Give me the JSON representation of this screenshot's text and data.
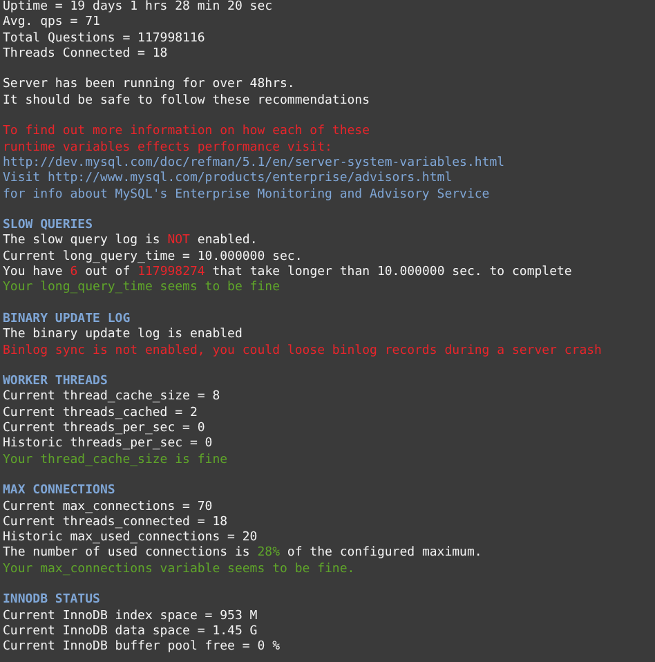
{
  "blocks": [
    {
      "lines": [
        {
          "segments": [
            {
              "text": "Uptime = 19 days 1 hrs 28 min 20 sec",
              "kind": "plain"
            }
          ]
        },
        {
          "segments": [
            {
              "text": "Avg. qps = 71",
              "kind": "plain"
            }
          ]
        },
        {
          "segments": [
            {
              "text": "Total Questions = 117998116",
              "kind": "plain"
            }
          ]
        },
        {
          "segments": [
            {
              "text": "Threads Connected = 18",
              "kind": "plain"
            }
          ]
        }
      ]
    },
    {
      "lines": [
        {
          "segments": [
            {
              "text": "Server has been running for over 48hrs.",
              "kind": "plain"
            }
          ]
        },
        {
          "segments": [
            {
              "text": "It should be safe to follow these recommendations",
              "kind": "plain"
            }
          ]
        }
      ]
    },
    {
      "lines": [
        {
          "segments": [
            {
              "text": "To find out more information on how each of these",
              "kind": "alert"
            }
          ]
        },
        {
          "segments": [
            {
              "text": "runtime variables effects performance visit:",
              "kind": "alert"
            }
          ]
        },
        {
          "segments": [
            {
              "text": "http://dev.mysql.com/doc/refman/5.1/en/server-system-variables.html",
              "kind": "info"
            }
          ]
        },
        {
          "segments": [
            {
              "text": "Visit http://www.mysql.com/products/enterprise/advisors.html",
              "kind": "info"
            }
          ]
        },
        {
          "segments": [
            {
              "text": "for info about MySQL's Enterprise Monitoring and Advisory Service",
              "kind": "info"
            }
          ]
        }
      ]
    },
    {
      "lines": [
        {
          "segments": [
            {
              "text": "SLOW QUERIES",
              "kind": "heading"
            }
          ]
        },
        {
          "segments": [
            {
              "text": "The slow query log is ",
              "kind": "plain"
            },
            {
              "text": "NOT",
              "kind": "alert"
            },
            {
              "text": " enabled.",
              "kind": "plain"
            }
          ]
        },
        {
          "segments": [
            {
              "text": "Current long_query_time = 10.000000 sec.",
              "kind": "plain"
            }
          ]
        },
        {
          "segments": [
            {
              "text": "You have ",
              "kind": "plain"
            },
            {
              "text": "6",
              "kind": "alert"
            },
            {
              "text": " out of ",
              "kind": "plain"
            },
            {
              "text": "117998274",
              "kind": "alert"
            },
            {
              "text": " that take longer than 10.000000 sec. to complete",
              "kind": "plain"
            }
          ]
        },
        {
          "segments": [
            {
              "text": "Your long_query_time seems to be fine",
              "kind": "ok"
            }
          ]
        }
      ]
    },
    {
      "lines": [
        {
          "segments": [
            {
              "text": "BINARY UPDATE LOG",
              "kind": "heading"
            }
          ]
        },
        {
          "segments": [
            {
              "text": "The binary update log is enabled",
              "kind": "plain"
            }
          ]
        },
        {
          "segments": [
            {
              "text": "Binlog sync is not enabled, you could loose binlog records during a server crash",
              "kind": "alert"
            }
          ]
        }
      ]
    },
    {
      "lines": [
        {
          "segments": [
            {
              "text": "WORKER THREADS",
              "kind": "heading"
            }
          ]
        },
        {
          "segments": [
            {
              "text": "Current thread_cache_size = 8",
              "kind": "plain"
            }
          ]
        },
        {
          "segments": [
            {
              "text": "Current threads_cached = 2",
              "kind": "plain"
            }
          ]
        },
        {
          "segments": [
            {
              "text": "Current threads_per_sec = 0",
              "kind": "plain"
            }
          ]
        },
        {
          "segments": [
            {
              "text": "Historic threads_per_sec = 0",
              "kind": "plain"
            }
          ]
        },
        {
          "segments": [
            {
              "text": "Your thread_cache_size is fine",
              "kind": "ok"
            }
          ]
        }
      ]
    },
    {
      "lines": [
        {
          "segments": [
            {
              "text": "MAX CONNECTIONS",
              "kind": "heading"
            }
          ]
        },
        {
          "segments": [
            {
              "text": "Current max_connections = 70",
              "kind": "plain"
            }
          ]
        },
        {
          "segments": [
            {
              "text": "Current threads_connected = 18",
              "kind": "plain"
            }
          ]
        },
        {
          "segments": [
            {
              "text": "Historic max_used_connections = 20",
              "kind": "plain"
            }
          ]
        },
        {
          "segments": [
            {
              "text": "The number of used connections is ",
              "kind": "plain"
            },
            {
              "text": "28%",
              "kind": "ok"
            },
            {
              "text": " of the configured maximum.",
              "kind": "plain"
            }
          ]
        },
        {
          "segments": [
            {
              "text": "Your max_connections variable seems to be fine.",
              "kind": "ok"
            }
          ]
        }
      ]
    },
    {
      "lines": [
        {
          "segments": [
            {
              "text": "INNODB STATUS",
              "kind": "heading"
            }
          ]
        },
        {
          "segments": [
            {
              "text": "Current InnoDB index space = 953 M",
              "kind": "plain"
            }
          ]
        },
        {
          "segments": [
            {
              "text": "Current InnoDB data space = 1.45 G",
              "kind": "plain"
            }
          ]
        },
        {
          "segments": [
            {
              "text": "Current InnoDB buffer pool free = 0 %",
              "kind": "plain"
            }
          ]
        }
      ]
    }
  ]
}
